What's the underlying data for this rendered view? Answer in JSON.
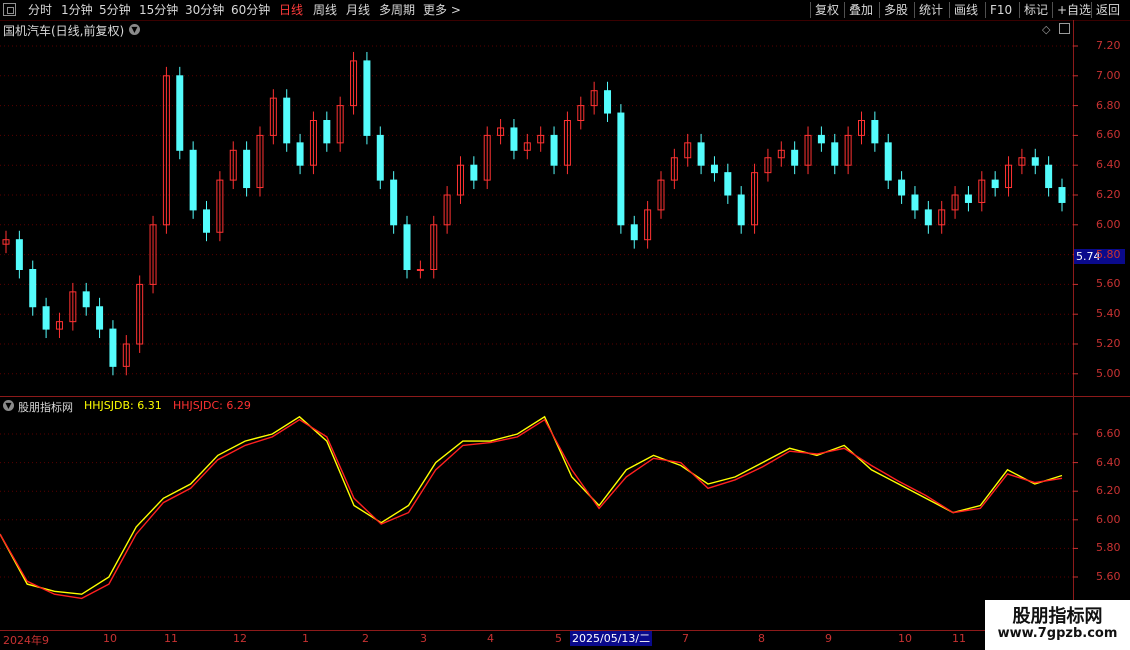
{
  "toolbar": {
    "left_items": [
      "分时",
      "1分钟",
      "5分钟",
      "15分钟",
      "30分钟",
      "60分钟",
      "日线",
      "周线",
      "月线",
      "多周期",
      "更多 >"
    ],
    "active_item": "日线",
    "right_items": [
      "复权",
      "叠加",
      "多股",
      "统计",
      "画线",
      "F10",
      "标记",
      "+自选",
      "返回"
    ]
  },
  "price_panel": {
    "title": "国机汽车(日线,前复权)",
    "current_price": "5.74",
    "y_ticks": [
      "7.20",
      "7.00",
      "6.80",
      "6.60",
      "6.40",
      "6.20",
      "6.00",
      "5.80",
      "5.60",
      "5.40",
      "5.20",
      "5.00"
    ]
  },
  "indicator_panel": {
    "name": "股朋指标网",
    "line1_label": "HHJSJDB: 6.31",
    "line2_label": "HHJSJDC: 6.29",
    "y_ticks": [
      "6.60",
      "6.40",
      "6.20",
      "6.00",
      "5.80",
      "5.60"
    ]
  },
  "x_axis": {
    "labels": [
      "2024年9",
      "10",
      "11",
      "12",
      "1",
      "2",
      "3",
      "4",
      "5",
      "7",
      "8",
      "9",
      "10",
      "11"
    ],
    "highlight": "2025/05/13/二"
  },
  "watermark": {
    "title": "股朋指标网",
    "url": "www.7gpzb.com"
  },
  "colors": {
    "up": "#ff3232",
    "down": "#54fcfc",
    "line1": "#ffff00",
    "line2": "#ff2020",
    "axis": "#c83232"
  },
  "chart_data": [
    {
      "type": "candlestick",
      "title": "国机汽车(日线,前复权)",
      "ylim": [
        4.95,
        7.3
      ],
      "note_current": 5.74,
      "series": [
        {
          "values": [
            5.9,
            5.7,
            5.45,
            5.3,
            5.35,
            5.55,
            5.45,
            5.3,
            5.05,
            5.2,
            5.6,
            6.0,
            7.0,
            6.5,
            6.1,
            5.95,
            6.3,
            6.5,
            6.25,
            6.6,
            6.85,
            6.55,
            6.4,
            6.7,
            6.55,
            6.8,
            7.1,
            6.6,
            6.3,
            6.0,
            5.7,
            5.7,
            6.0,
            6.2,
            6.4,
            6.3,
            6.6,
            6.65,
            6.5,
            6.55,
            6.6,
            6.4,
            6.7,
            6.8,
            6.9,
            6.75,
            6.0,
            5.9,
            6.1,
            6.3,
            6.45,
            6.55,
            6.4,
            6.35,
            6.2,
            6.0,
            6.35,
            6.45,
            6.5,
            6.4,
            6.6,
            6.55,
            6.4,
            6.6,
            6.7,
            6.55,
            6.3,
            6.2,
            6.1,
            6.0,
            6.1,
            6.2,
            6.15,
            6.3,
            6.25,
            6.4,
            6.45,
            6.4,
            6.25,
            6.15
          ]
        }
      ]
    },
    {
      "type": "line",
      "ylim": [
        5.45,
        6.75
      ],
      "series": [
        {
          "name": "HHJSJDB",
          "values": [
            5.9,
            5.55,
            5.5,
            5.48,
            5.6,
            5.95,
            6.15,
            6.25,
            6.45,
            6.55,
            6.6,
            6.72,
            6.55,
            6.1,
            5.98,
            6.1,
            6.4,
            6.55,
            6.55,
            6.6,
            6.72,
            6.3,
            6.1,
            6.35,
            6.45,
            6.38,
            6.25,
            6.3,
            6.4,
            6.5,
            6.45,
            6.52,
            6.35,
            6.25,
            6.15,
            6.05,
            6.1,
            6.35,
            6.25,
            6.31
          ]
        },
        {
          "name": "HHJSJDC",
          "values": [
            5.9,
            5.57,
            5.48,
            5.45,
            5.55,
            5.9,
            6.12,
            6.22,
            6.42,
            6.52,
            6.58,
            6.7,
            6.58,
            6.15,
            5.97,
            6.05,
            6.35,
            6.52,
            6.54,
            6.58,
            6.7,
            6.35,
            6.08,
            6.3,
            6.43,
            6.4,
            6.22,
            6.28,
            6.37,
            6.48,
            6.46,
            6.5,
            6.38,
            6.27,
            6.17,
            6.05,
            6.08,
            6.32,
            6.26,
            6.29
          ]
        }
      ]
    }
  ]
}
